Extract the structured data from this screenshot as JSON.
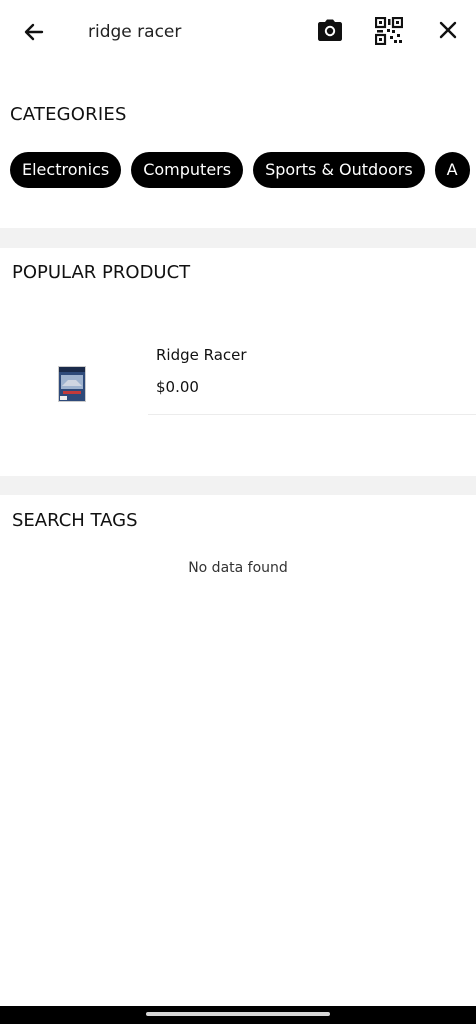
{
  "header": {
    "search_value": "ridge racer",
    "icons": {
      "back": "arrow-left-icon",
      "camera": "camera-icon",
      "qr": "qr-scan-icon",
      "close": "close-icon"
    }
  },
  "categories": {
    "title": "CATEGORIES",
    "items": [
      "Electronics",
      "Computers",
      "Sports & Outdoors",
      "A"
    ]
  },
  "popular": {
    "title": "POPULAR PRODUCT",
    "products": [
      {
        "name": "Ridge Racer",
        "price": "$0.00"
      }
    ]
  },
  "search_tags": {
    "title": "SEARCH TAGS",
    "empty_text": "No data found"
  },
  "colors": {
    "chip_bg": "#000000",
    "chip_text": "#ffffff",
    "section_band": "#f2f2f2"
  }
}
